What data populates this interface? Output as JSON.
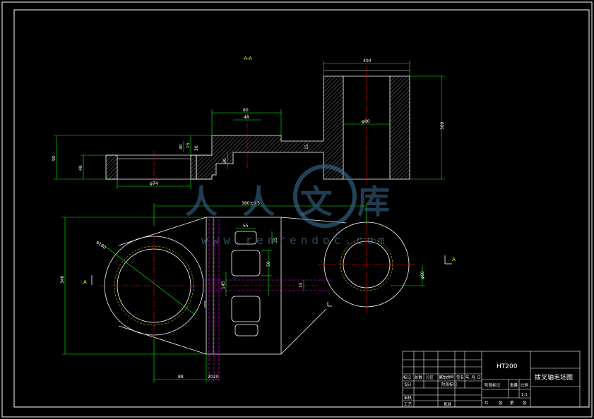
{
  "section_label": "A-A",
  "view_marker_left": "A",
  "view_marker_right": "A",
  "dimensions": {
    "top_width": "400",
    "top_height": "300",
    "hub_bore": "φ80",
    "left_bore": "φ74",
    "total_height": "90",
    "left_height": "48",
    "mid_width": "80",
    "mid_width_inner": "48",
    "rib_h1": "15",
    "rib_h2": "40",
    "rib_h3": "30",
    "rib_h4": "30",
    "rib_h5": "15",
    "overall_length": "380±0.5",
    "plan_height": "340",
    "plan_dia_big": "φ180",
    "slot_width": "55",
    "slot_h1": "50",
    "slot_h2": "25",
    "slot_h3": "15",
    "small_dim": "145",
    "right_dia": "φ60",
    "bottom_1": "88",
    "bottom_2": "20",
    "bottom_3": "20"
  },
  "watermark": {
    "chinese": "人人文库",
    "url": "www.renrendoc.com"
  },
  "title_block": {
    "material": "HT200",
    "part_name": "拨叉轴毛坯图",
    "scale_label": "比例",
    "scale_value": "1:1",
    "weight_label": "重量",
    "sheet_label": "共",
    "sheet_label2": "张",
    "sheet_of": "第",
    "designer": "设计",
    "checker": "审核",
    "process": "工艺",
    "approve": "批准",
    "headers": [
      "标记",
      "处数",
      "分区",
      "更改文件号",
      "签名",
      "年、月、日"
    ],
    "stage_label": "阶段标记"
  },
  "colors": {
    "outline": "#ffffff",
    "dimension": "#00ff00",
    "centerline": "#ff0000",
    "hidden": "#ff00ff",
    "hatch": "#ffffff",
    "label": "#ffff00"
  }
}
